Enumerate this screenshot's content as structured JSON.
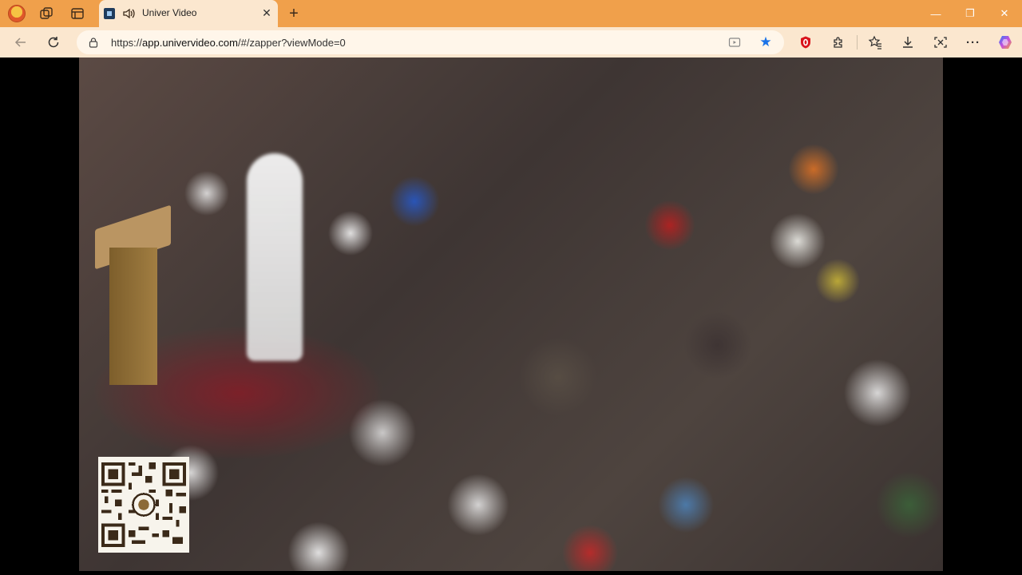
{
  "browser": {
    "tab": {
      "title": "Univer Video",
      "close_glyph": "✕",
      "favicon": "video-app-favicon",
      "audio_icon": "speaker-icon"
    },
    "new_tab_glyph": "+",
    "window_controls": {
      "minimize": "—",
      "maximize": "❐",
      "close": "✕"
    },
    "address": {
      "url_prefix": "https://",
      "url_host": "app.univervideo.com",
      "url_rest": "/#/zapper?viewMode=0",
      "bookmarked": true
    },
    "toolbar_more": "···"
  },
  "colors": {
    "titlebar": "#f0a04b",
    "toolbar": "#fbe7cf",
    "accent_star": "#1a73e8",
    "content_bg": "#000000"
  },
  "video": {
    "scene": "crowd-gathering",
    "has_qr_code": true
  }
}
